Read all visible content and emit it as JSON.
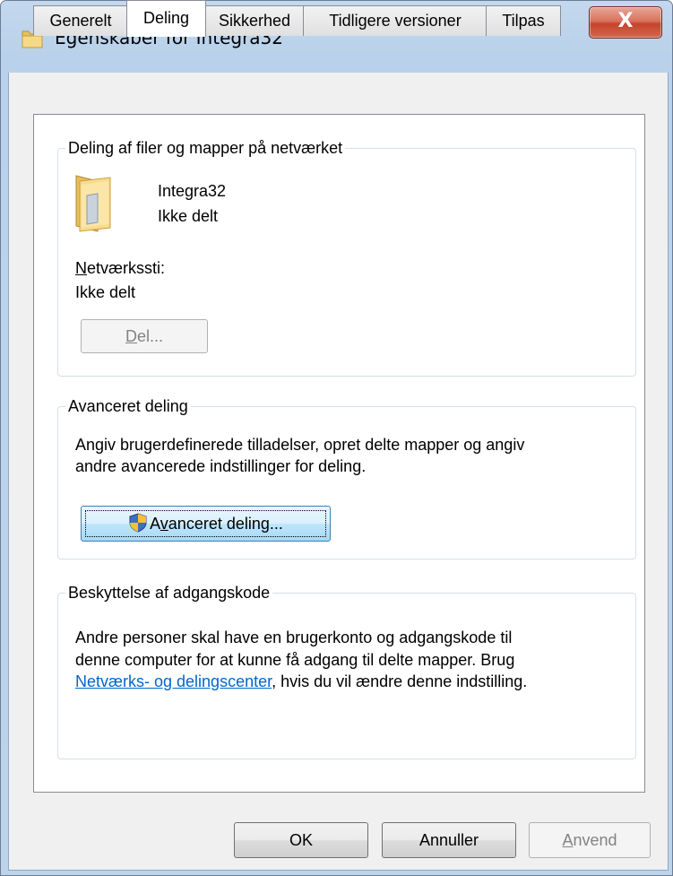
{
  "window": {
    "title": "Egenskaber for Integra32",
    "close_label": "X"
  },
  "tabs": [
    {
      "label": "Generelt",
      "active": false
    },
    {
      "label": "Deling",
      "active": true
    },
    {
      "label": "Sikkerhed",
      "active": false
    },
    {
      "label": "Tidligere versioner",
      "active": false
    },
    {
      "label": "Tilpas",
      "active": false
    }
  ],
  "sharing": {
    "group_title": "Deling af filer og mapper på netværket",
    "folder_name": "Integra32",
    "folder_status": "Ikke delt",
    "network_path_label_accel": "N",
    "network_path_label_rest": "etværkssti:",
    "network_path_value": "Ikke delt",
    "share_button_accel": "D",
    "share_button_rest": "el..."
  },
  "advanced": {
    "group_title": "Avanceret deling",
    "description_line1": "Angiv brugerdefinerede tilladelser, opret delte mapper og angiv",
    "description_line2": "andre avancerede indstillinger for deling.",
    "button_pre": "A",
    "button_accel": "v",
    "button_rest": "anceret deling..."
  },
  "password": {
    "group_title": "Beskyttelse af adgangskode",
    "line1": "Andre personer skal have en brugerkonto og adgangskode til",
    "line2": "denne computer for at kunne få adgang til delte mapper. Brug",
    "link": "Netværks- og delingscenter",
    "line3_rest": ", hvis du vil ændre denne indstilling."
  },
  "footer": {
    "ok_label": "OK",
    "cancel_label": "Annuller",
    "apply_accel": "A",
    "apply_rest": "nvend"
  },
  "colors": {
    "link": "#0066cc",
    "folder": "#f2d27a",
    "close_button": "#c7432b"
  }
}
